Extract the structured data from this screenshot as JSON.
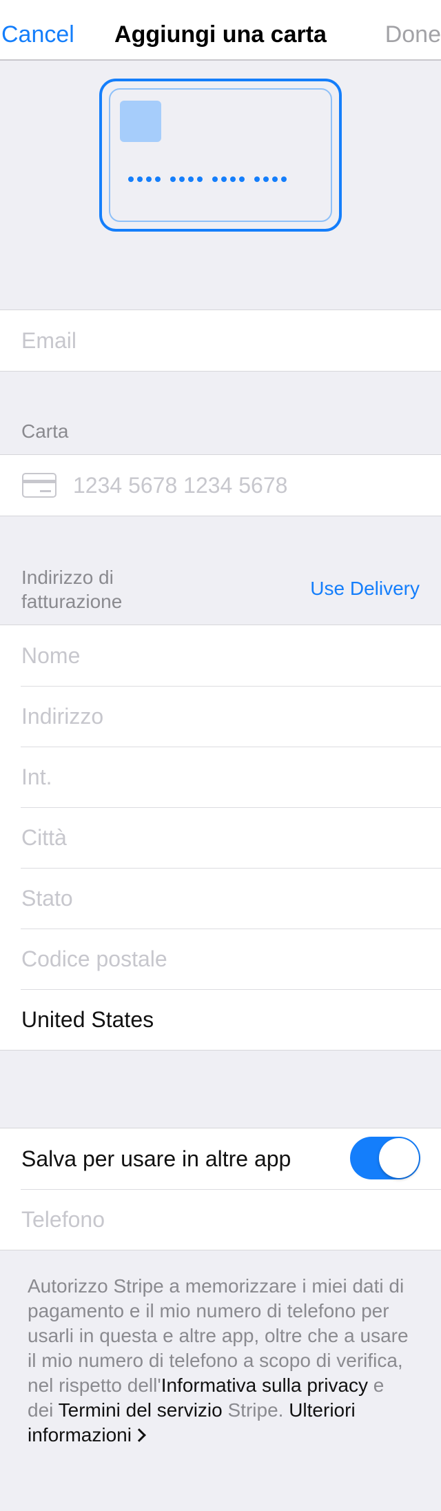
{
  "nav": {
    "cancel": "Cancel",
    "title": "Aggiungi una carta",
    "done": "Done"
  },
  "email": {
    "placeholder": "Email"
  },
  "card": {
    "header": "Carta",
    "number_placeholder": "1234 5678 1234 5678"
  },
  "billing": {
    "header": "Indirizzo di fatturazione",
    "header_line1": "Indirizzo di",
    "header_line2": "fatturazione",
    "use_delivery": "Use Delivery",
    "fields": {
      "name": "Nome",
      "address": "Indirizzo",
      "apt": "Int.",
      "city": "Città",
      "state": "Stato",
      "zip": "Codice postale",
      "country": "United States"
    }
  },
  "save": {
    "label": "Salva per usare in altre app",
    "toggle_on": true,
    "phone_placeholder": "Telefono"
  },
  "footer": {
    "part1": "Autorizzo Stripe a memorizzare i miei dati di pagamento e il mio numero di telefono per usarli in questa e altre app, oltre che a usare il mio numero di telefono a scopo di verifica, nel rispetto dell'",
    "privacy_link": "Informativa sulla privacy",
    "part2": " e dei ",
    "terms_link": "Termini del servizio",
    "part3": " Stripe. ",
    "more_link": "Ulteriori informazioni"
  },
  "colors": {
    "accent": "#147efb",
    "background": "#efeff4",
    "placeholder": "#c7c7cd"
  }
}
